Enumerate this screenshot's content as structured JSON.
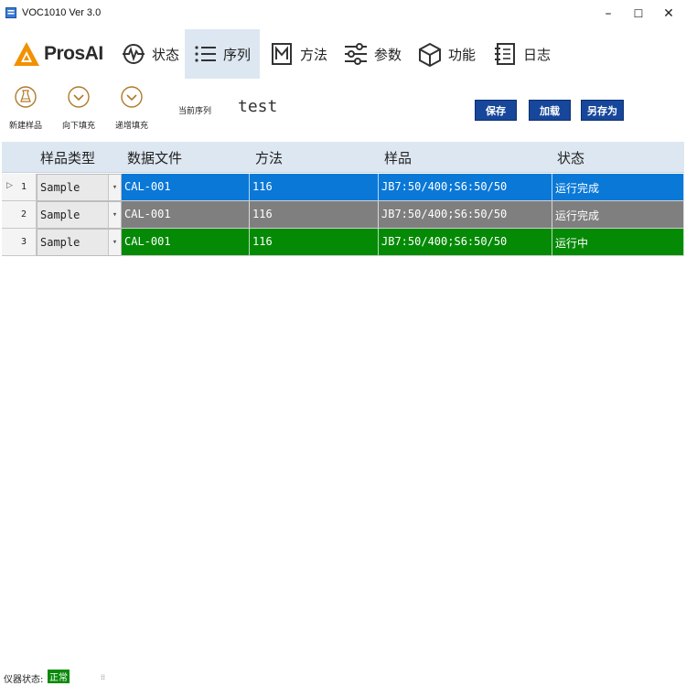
{
  "window": {
    "title": "VOC1010 Ver 3.0",
    "minimize": "–",
    "maximize": "☐",
    "close": "✕"
  },
  "brand": {
    "name": "ProsAI",
    "accent": "#f29100"
  },
  "nav": {
    "tabs": [
      {
        "label": "状态",
        "icon": "heartbeat-icon",
        "active": false
      },
      {
        "label": "序列",
        "icon": "list-icon",
        "active": true
      },
      {
        "label": "方法",
        "icon": "m-box-icon",
        "active": false
      },
      {
        "label": "参数",
        "icon": "sliders-icon",
        "active": false
      },
      {
        "label": "功能",
        "icon": "cube-icon",
        "active": false
      },
      {
        "label": "日志",
        "icon": "log-icon",
        "active": false
      }
    ]
  },
  "toolbar": {
    "new_sample": "新建样品",
    "fill_down": "向下填充",
    "increment_fill": "递增填充",
    "current_sequence_label": "当前序列",
    "current_sequence_value": "test",
    "save": "保存",
    "load": "加载",
    "save_as": "另存为"
  },
  "grid": {
    "columns": [
      "样品类型",
      "数据文件",
      "方法",
      "样品",
      "状态"
    ],
    "rows": [
      {
        "num": "1",
        "type": "Sample",
        "file": "CAL-001",
        "method": "116",
        "sample": "JB7:50/400;S6:50/50",
        "status": "运行完成",
        "color": "#0a78d7",
        "current": true
      },
      {
        "num": "2",
        "type": "Sample",
        "file": "CAL-001",
        "method": "116",
        "sample": "JB7:50/400;S6:50/50",
        "status": "运行完成",
        "color": "#7f7f7f",
        "current": false
      },
      {
        "num": "3",
        "type": "Sample",
        "file": "CAL-001",
        "method": "116",
        "sample": "JB7:50/400;S6:50/50",
        "status": "运行中",
        "color": "#058a06",
        "current": false
      }
    ]
  },
  "statusbar": {
    "label": "仪器状态:",
    "value": "正常",
    "color": "#0a8a0a"
  }
}
